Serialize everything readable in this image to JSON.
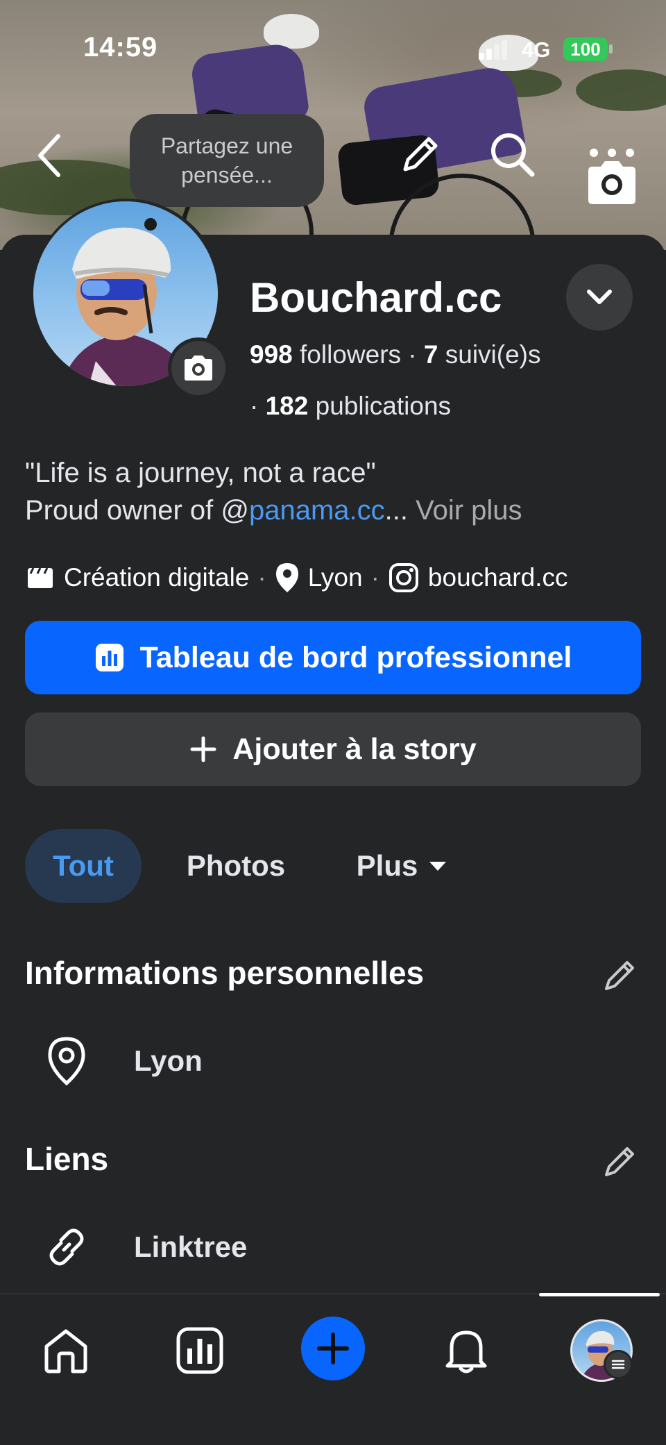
{
  "status_bar": {
    "time": "14:59",
    "network": "4G",
    "battery": "100"
  },
  "header": {
    "thought_bubble": [
      "Partagez une",
      "pensée..."
    ]
  },
  "profile": {
    "name": "Bouchard.cc",
    "followers_count": "998",
    "followers_label": " followers · ",
    "following_count": "7",
    "following_label": " suivi(e)s",
    "posts_prefix": "· ",
    "posts_count": "182",
    "posts_label": " publications"
  },
  "bio": {
    "line1": "\"Life is a journey, not a race\"",
    "line2_prefix": "Proud owner of @",
    "line2_link": "panama.cc",
    "line2_ellipsis": "... ",
    "see_more": "Voir plus"
  },
  "meta": {
    "category": "Création digitale",
    "location": "Lyon",
    "instagram": "bouchard.cc",
    "separator": "·"
  },
  "buttons": {
    "professional_dashboard": "Tableau de bord professionnel",
    "add_to_story": "Ajouter à la story"
  },
  "tabs": {
    "all": "Tout",
    "photos": "Photos",
    "more": "Plus"
  },
  "sections": {
    "personal_info_title": "Informations personnelles",
    "personal_info_location": "Lyon",
    "links_title": "Liens",
    "link_item": "Linktree"
  },
  "colors": {
    "accent_blue": "#0866ff",
    "link_blue": "#4a9af2",
    "background": "#242527",
    "surface": "#3a3b3d",
    "battery_green": "#34c759"
  },
  "icons": {
    "back": "chevron-left-icon",
    "edit": "pencil-icon",
    "search": "search-icon",
    "camera": "camera-icon",
    "dropdown": "chevron-down-icon",
    "location": "location-pin-icon",
    "instagram": "instagram-icon",
    "link": "link-icon",
    "home": "home-icon",
    "dashboard": "bar-chart-icon",
    "create": "plus-icon",
    "notifications": "bell-icon"
  }
}
